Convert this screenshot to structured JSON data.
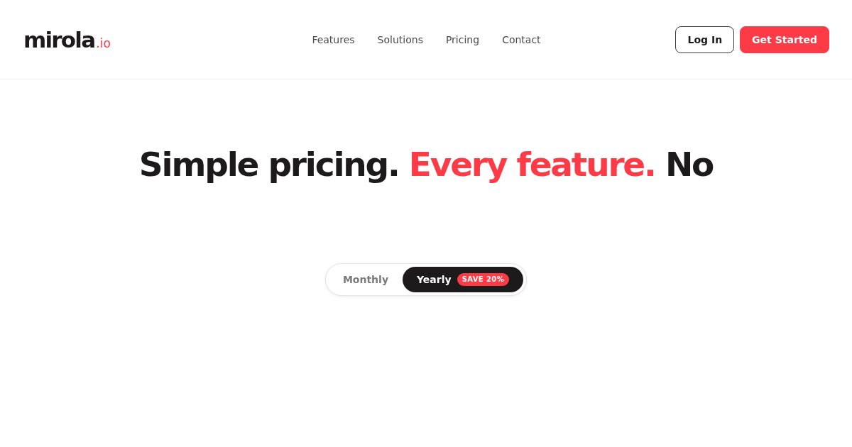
{
  "logo": {
    "name": "mirola",
    "suffix": ".io"
  },
  "nav": [
    {
      "label": "Features"
    },
    {
      "label": "Solutions"
    },
    {
      "label": "Pricing"
    },
    {
      "label": "Contact"
    }
  ],
  "actions": [
    {
      "label": "Log In",
      "kind": "outline"
    },
    {
      "label": "Get Started",
      "kind": "primary"
    }
  ],
  "headline": [
    {
      "text": "Simple pricing.",
      "accent": false
    },
    {
      "text": "Every feature.",
      "accent": true
    },
    {
      "text": "No",
      "accent": false
    }
  ],
  "billing_toggle": [
    {
      "label": "Monthly",
      "selected": false
    },
    {
      "label": "Yearly",
      "selected": true,
      "badge": "SAVE 20%"
    }
  ]
}
